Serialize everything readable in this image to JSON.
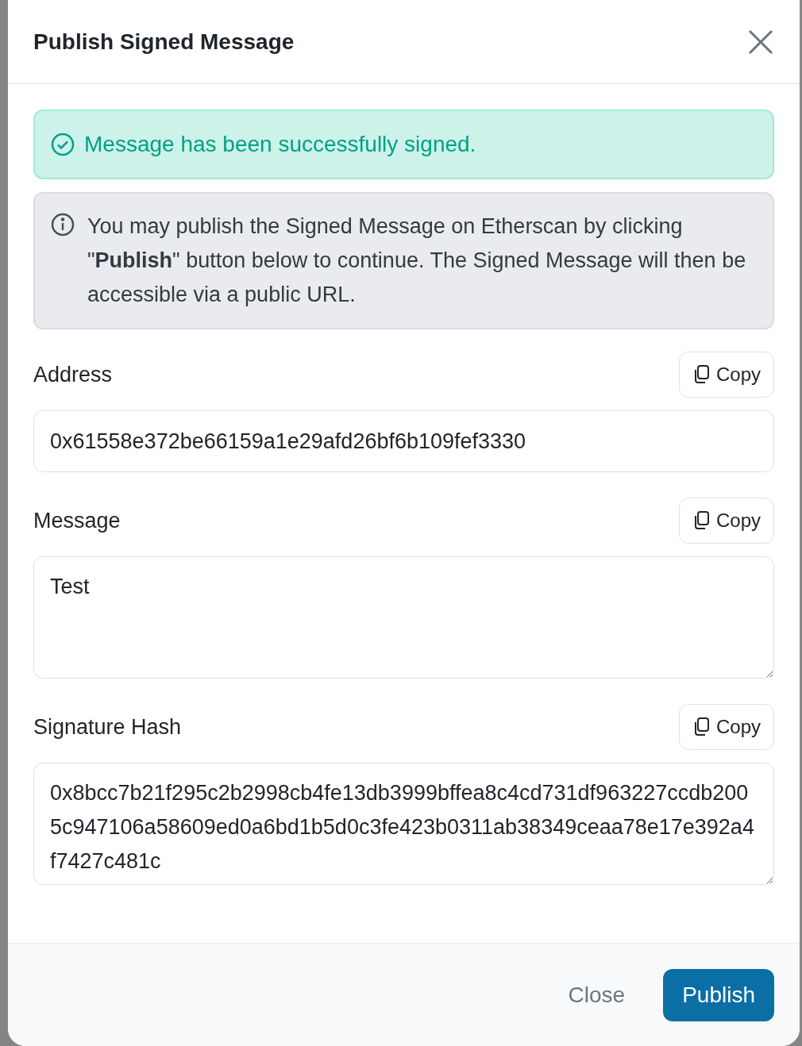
{
  "dialog": {
    "title": "Publish Signed Message"
  },
  "success_alert": {
    "text": "Message has been successfully signed."
  },
  "info_alert": {
    "text": "You may publish the Signed Message on Etherscan by clicking \"**Publish**\" button below to continue. The Signed Message will then be accessible via a public URL."
  },
  "fields": [
    {
      "label": "Address",
      "copy": "Copy",
      "kind": "input",
      "value": "0x61558e372be66159a1e29afd26bf6b109fef3330"
    },
    {
      "label": "Message",
      "copy": "Copy",
      "kind": "textarea",
      "value": "Test"
    },
    {
      "label": "Signature Hash",
      "copy": "Copy",
      "kind": "textarea",
      "value": "0x8bcc7b21f295c2b2998cb4fe13db3999bffea8c4cd731df963227ccdb2005c947106a58609ed0a6bd1b5d0c3fe423b0311ab38349ceaa78e17e392a4f7427c481c"
    }
  ],
  "footer": {
    "close": "Close",
    "publish": "Publish"
  }
}
